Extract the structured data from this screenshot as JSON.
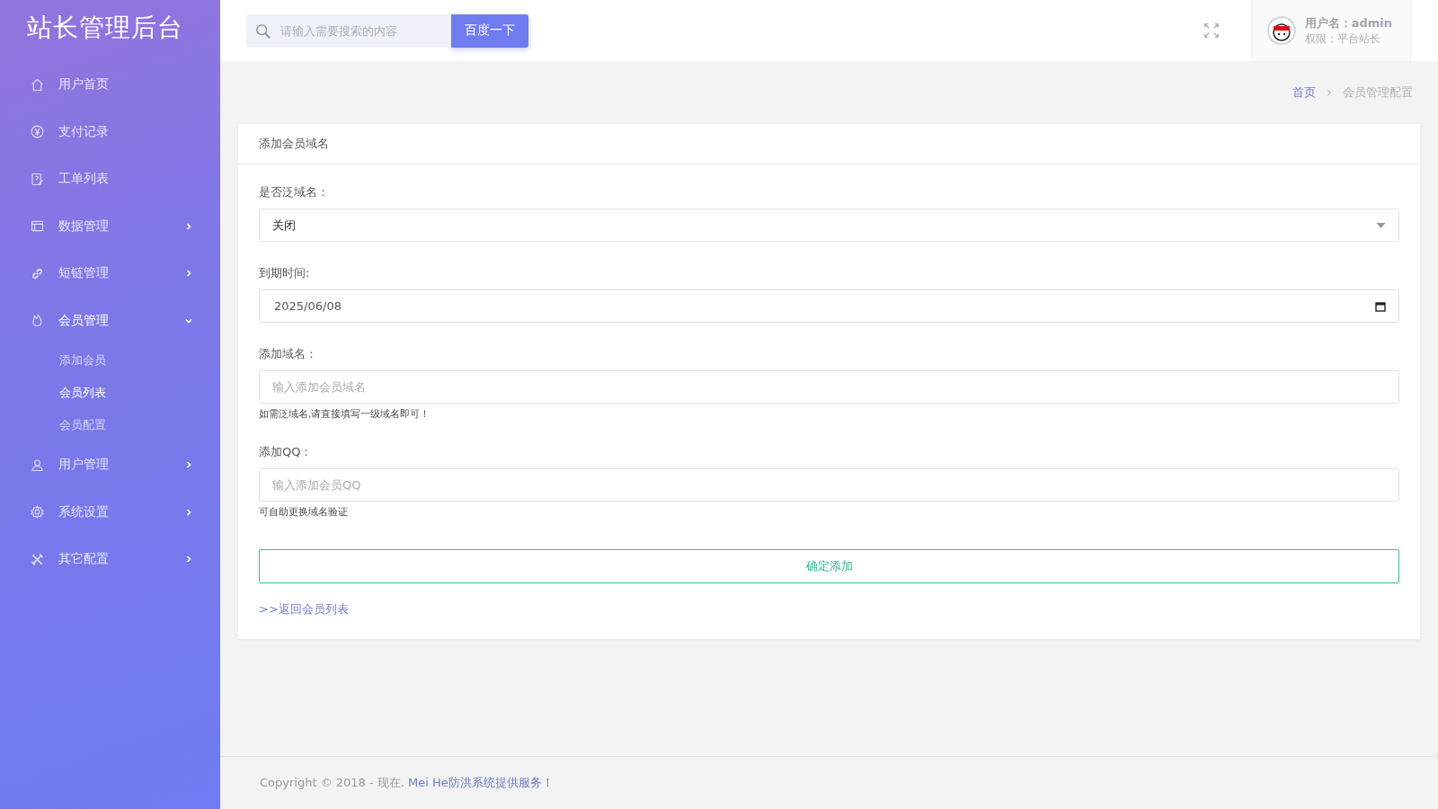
{
  "sidebar": {
    "title": "站长管理后台",
    "items": [
      {
        "label": "用户首页",
        "kind": "link"
      },
      {
        "label": "支付记录",
        "kind": "link"
      },
      {
        "label": "工单列表",
        "kind": "link"
      },
      {
        "label": "数据管理",
        "kind": "group",
        "expanded": false
      },
      {
        "label": "短链管理",
        "kind": "group",
        "expanded": false
      },
      {
        "label": "会员管理",
        "kind": "group",
        "expanded": true,
        "children": [
          {
            "label": "添加会员",
            "selected": false
          },
          {
            "label": "会员列表",
            "selected": true
          },
          {
            "label": "会员配置",
            "selected": false
          }
        ]
      },
      {
        "label": "用户管理",
        "kind": "group",
        "expanded": false
      },
      {
        "label": "系统设置",
        "kind": "group",
        "expanded": false
      },
      {
        "label": "其它配置",
        "kind": "group",
        "expanded": false
      }
    ]
  },
  "header": {
    "search": {
      "placeholder": "请输入需要搜索的内容"
    },
    "search_button": "百度一下",
    "user": {
      "name_label": "用户名：",
      "name": "admin",
      "role": "权限：平台站长"
    }
  },
  "breadcrumb": [
    {
      "label": "首页",
      "kind": "link"
    },
    {
      "label": "会员管理配置",
      "kind": "current"
    }
  ],
  "card": {
    "title": "添加会员域名",
    "fields": [
      {
        "label": "是否泛域名：",
        "kind": "select",
        "value": "关闭"
      },
      {
        "label": "到期时间:",
        "kind": "date",
        "value": "2025/06/08"
      },
      {
        "label": "添加域名：",
        "kind": "text",
        "placeholder": "输入添加会员域名",
        "help": "如需泛域名,请直接填写一级域名即可！"
      },
      {
        "label": "添加QQ：",
        "kind": "text",
        "placeholder": "输入添加会员QQ",
        "help": "可自助更换域名验证"
      }
    ],
    "submit": "确定添加",
    "back_link": ">>返回会员列表"
  },
  "footer": {
    "text": "Copyright © 2018 - 现在. ",
    "link": "Mei He防洪系统提供服务！"
  }
}
